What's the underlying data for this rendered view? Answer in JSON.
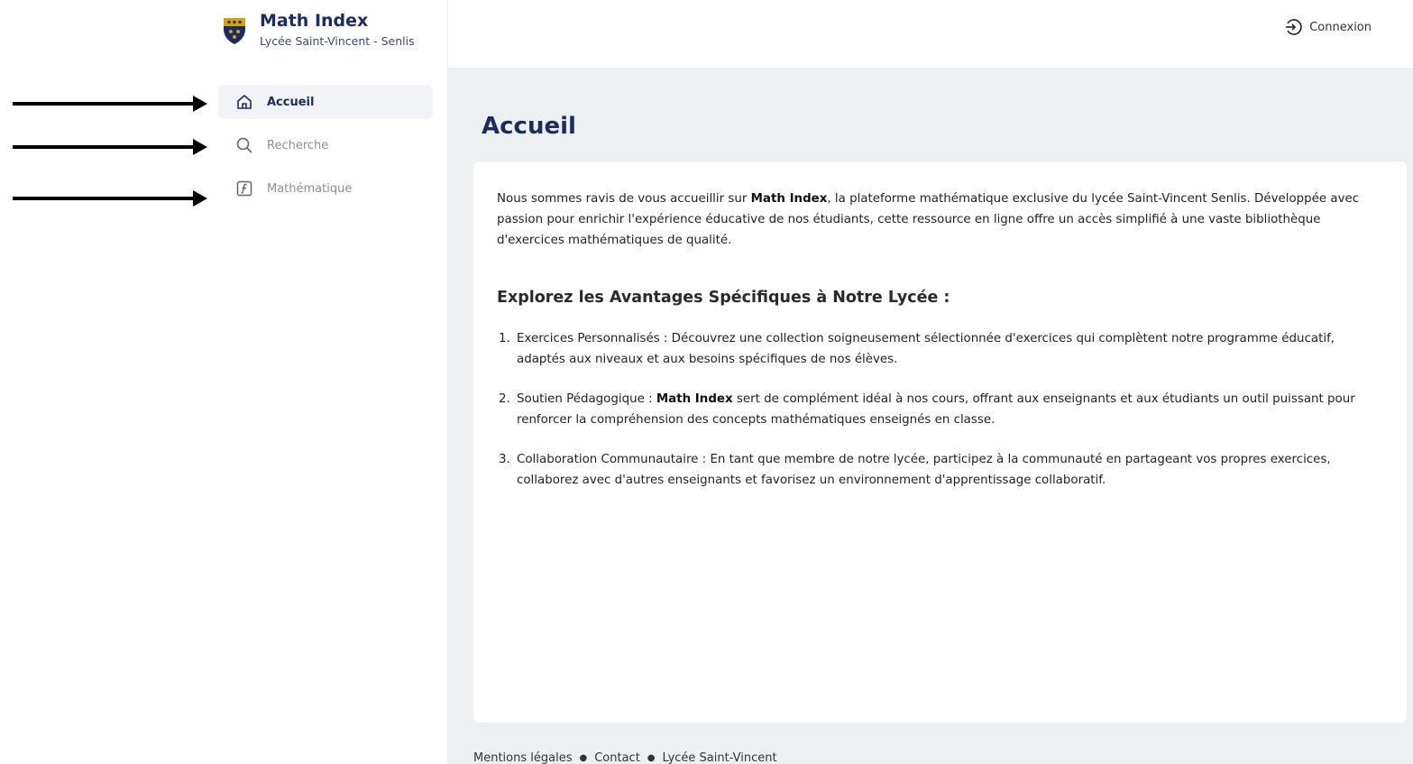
{
  "brand": {
    "title": "Math Index",
    "subtitle": "Lycée Saint-Vincent - Senlis",
    "shield_icon": "school-crest-icon"
  },
  "sidebar": {
    "items": [
      {
        "label": "Accueil",
        "icon": "home-icon",
        "active": true
      },
      {
        "label": "Recherche",
        "icon": "search-icon",
        "active": false
      },
      {
        "label": "Mathématique",
        "icon": "function-icon",
        "active": false
      }
    ]
  },
  "header": {
    "login_label": "Connexion",
    "login_icon": "login-icon"
  },
  "main": {
    "title": "Accueil",
    "intro": {
      "before": "Nous sommes ravis de vous accueillir sur ",
      "bold": "Math Index",
      "after": ", la plateforme mathématique exclusive du lycée Saint-Vincent Senlis. Développée avec passion pour enrichir l'expérience éducative de nos étudiants, cette ressource en ligne offre un accès simplifié à une vaste bibliothèque d'exercices mathématiques de qualité."
    },
    "section_title": "Explorez les Avantages Spécifiques à Notre Lycée :",
    "items": [
      {
        "num": "1.",
        "before": "Exercices Personnalisés : Découvrez une collection soigneusement sélectionnée d'exercices qui complètent notre programme éducatif, adaptés aux niveaux et aux besoins spécifiques de nos élèves.",
        "bold": "",
        "after": ""
      },
      {
        "num": "2.",
        "before": "Soutien Pédagogique : ",
        "bold": "Math Index",
        "after": " sert de complément idéal à nos cours, offrant aux enseignants et aux étudiants un outil puissant pour renforcer la compréhension des concepts mathématiques enseignés en classe."
      },
      {
        "num": "3.",
        "before": "Collaboration Communautaire : En tant que membre de notre lycée, participez à la communauté en partageant vos propres exercices, collaborez avec d'autres enseignants et favorisez un environnement d'apprentissage collaboratif.",
        "bold": "",
        "after": ""
      }
    ]
  },
  "footer": {
    "links": [
      "Mentions légales",
      "Contact",
      "Lycée Saint-Vincent"
    ],
    "separator": "●"
  },
  "colors": {
    "brand_navy": "#1e2b5e",
    "main_bg": "#edf0f2",
    "active_nav_bg": "#f1f3f6"
  }
}
